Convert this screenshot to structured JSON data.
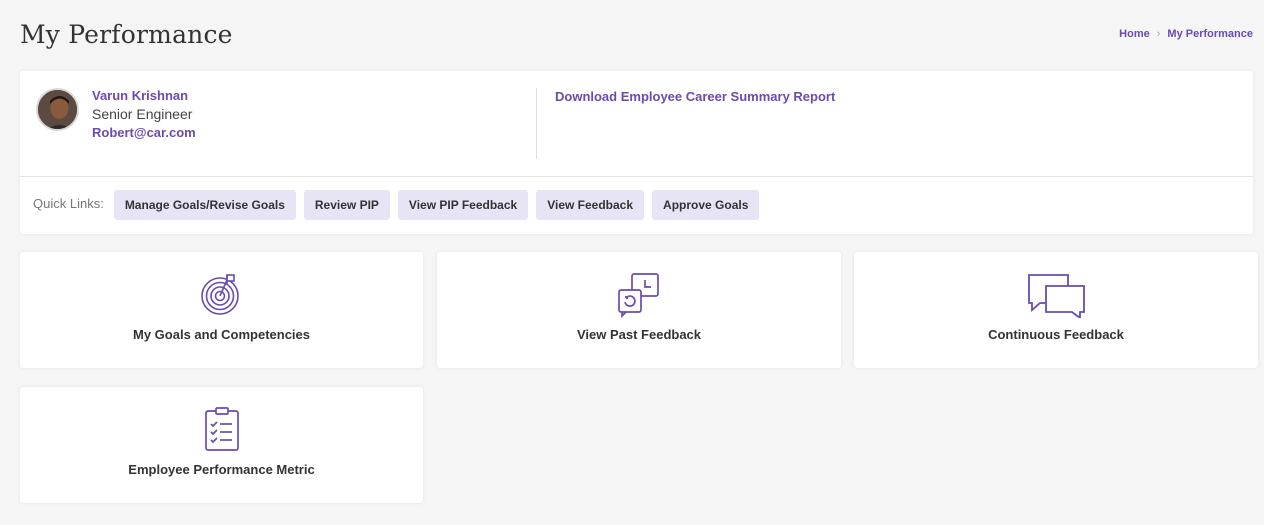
{
  "header": {
    "title": "My Performance",
    "breadcrumb": {
      "home": "Home",
      "separator": "›",
      "current": "My Performance"
    }
  },
  "profile": {
    "name": "Varun Krishnan",
    "role": "Senior Engineer",
    "email": "Robert@car.com",
    "download_link": "Download Employee Career Summary Report"
  },
  "quick_links": {
    "label": "Quick Links:",
    "items": [
      "Manage Goals/Revise Goals",
      "Review PIP",
      "View PIP Feedback",
      "View Feedback",
      "Approve Goals"
    ]
  },
  "tiles": [
    {
      "label": "My Goals and Competencies",
      "icon": "target-icon"
    },
    {
      "label": "View Past Feedback",
      "icon": "feedback-history-icon"
    },
    {
      "label": "Continuous Feedback",
      "icon": "chat-bubbles-icon"
    },
    {
      "label": "Employee Performance Metric",
      "icon": "clipboard-checklist-icon"
    }
  ],
  "colors": {
    "accent": "#6a4bb0",
    "quick_link_bg": "#e7e4f6",
    "background": "#f5f5f5"
  }
}
